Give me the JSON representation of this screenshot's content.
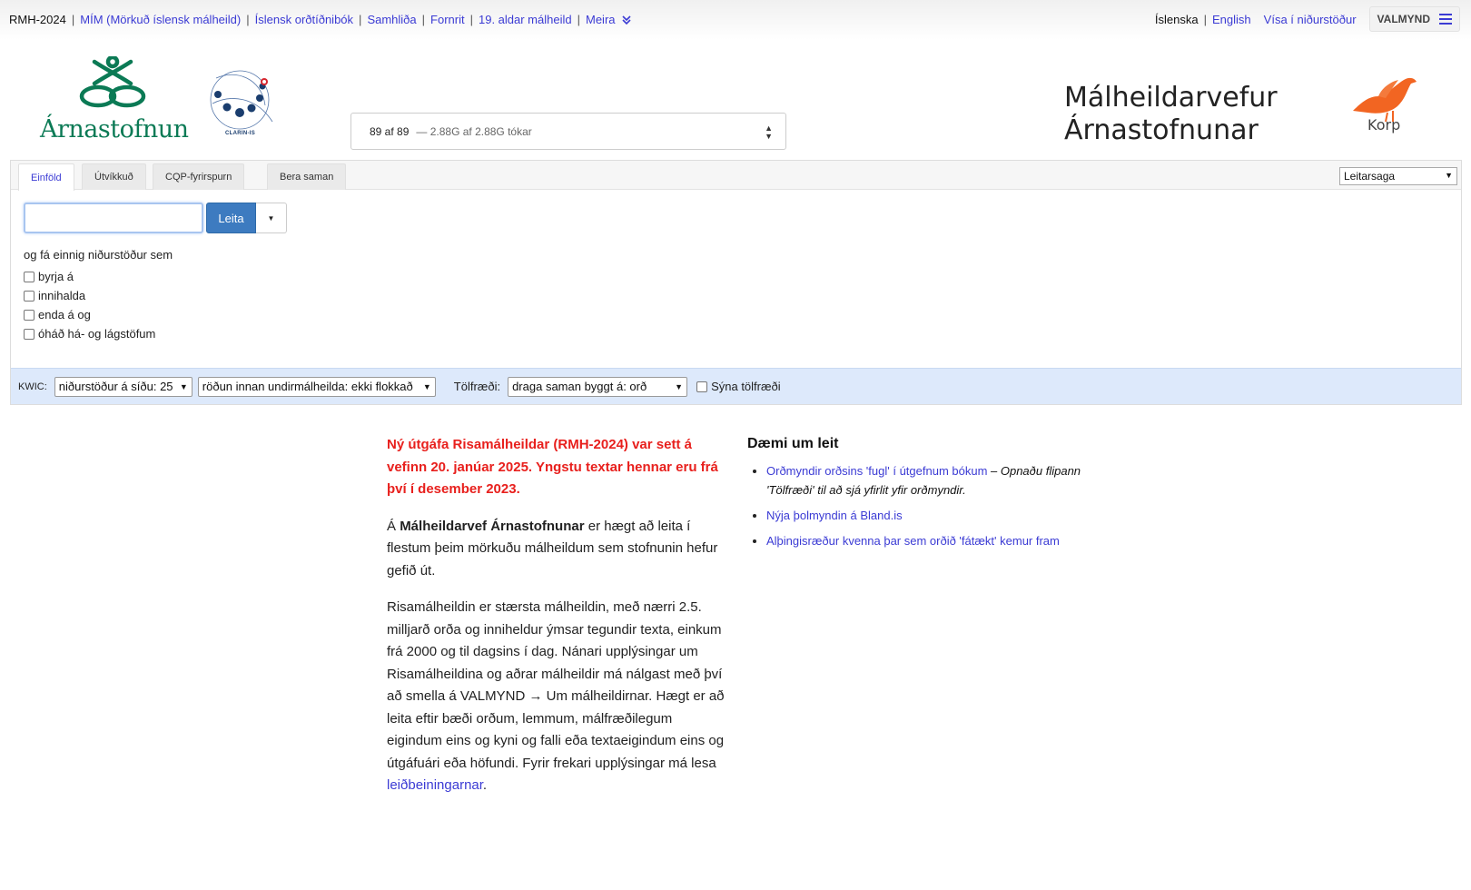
{
  "topnav": {
    "items": [
      {
        "label": "RMH-2024",
        "current": true
      },
      {
        "label": "MÍM (Mörkuð íslensk málheild)"
      },
      {
        "label": "Íslensk orðtíðnibók"
      },
      {
        "label": "Samhliða"
      },
      {
        "label": "Fornrit"
      },
      {
        "label": "19. aldar málheild"
      }
    ],
    "more_label": "Meira",
    "languages": [
      "Íslenska",
      "English"
    ],
    "show_results_label": "Vísa í niðurstöður",
    "menu_label": "VALMYND"
  },
  "header": {
    "institute_name": "Árnastofnun",
    "clarin_label": "CLARIN-IS",
    "corpus_count": "89 af 89",
    "corpus_tokens": "— 2.88G af 2.88G tókar",
    "title_line1": "Málheildarvefur",
    "title_line2": "Árnastofnunar",
    "korp_label": "Korp"
  },
  "search": {
    "tabs": [
      "Einföld",
      "Útvíkkuð",
      "CQP-fyrirspurn",
      "Bera saman"
    ],
    "active_tab": 0,
    "history_label": "Leitarsaga",
    "input_value": "",
    "search_button": "Leita",
    "options_lead": "og fá einnig niðurstöður sem",
    "options": [
      "byrja á",
      "innihalda",
      "enda á og",
      "óháð há- og lágstöfum"
    ]
  },
  "kwic": {
    "label": "KWIC:",
    "per_page": "niðurstöður á síðu: 25",
    "sort": "röðun innan undirmálheilda: ekki flokkað",
    "stats_label": "Tölfræði:",
    "stats_select": "draga saman byggt á: orð",
    "show_stats": "Sýna tölfræði"
  },
  "intro": {
    "news": "Ný útgáfa Risamálheildar (RMH-2024) var sett á vefinn 20. janúar 2025. Yngstu textar hennar eru frá því í desember 2023.",
    "p1_pre": "Á ",
    "p1_bold": "Málheildarvef Árnastofnunar",
    "p1_post": " er hægt að leita í flestum þeim mörkuðu málheildum sem stofnunin hefur gefið út.",
    "p2": "Risamálheildin er stærsta málheildin, með nærri 2.5. milljarð orða og inniheldur ýmsar tegundir texta, einkum frá 2000 og til dagsins í dag. Nánari upplýsingar um Risamálheildina og aðrar málheildir má nálgast með því að smella á VALMYND → Um málheildirnar. Hægt er að leita eftir bæði orðum, lemmum, málfræðilegum eigindum eins og kyni og falli eða textaeigindum eins og útgáfuári eða höfundi. Fyrir frekari upplýsingar má lesa",
    "p2_link": "leiðbeiningarnar",
    "p2_end": "."
  },
  "examples": {
    "title": "Dæmi um leit",
    "items": [
      {
        "link": "Orðmyndir orðsins 'fugl' í útgefnum bókum",
        "note": " – Opnaðu flipann 'Tölfræði' til að sjá yfirlit yfir orðmyndir."
      },
      {
        "link": "Nýja þolmyndin á Bland.is",
        "note": ""
      },
      {
        "link": "Alþingisræður kvenna þar sem orðið 'fátækt' kemur fram",
        "note": ""
      }
    ]
  },
  "colors": {
    "link": "#3b3bd4",
    "news": "#e8201d",
    "brand_green": "#0b7a55",
    "button": "#3d7bc0",
    "korp_orange": "#f26522"
  }
}
